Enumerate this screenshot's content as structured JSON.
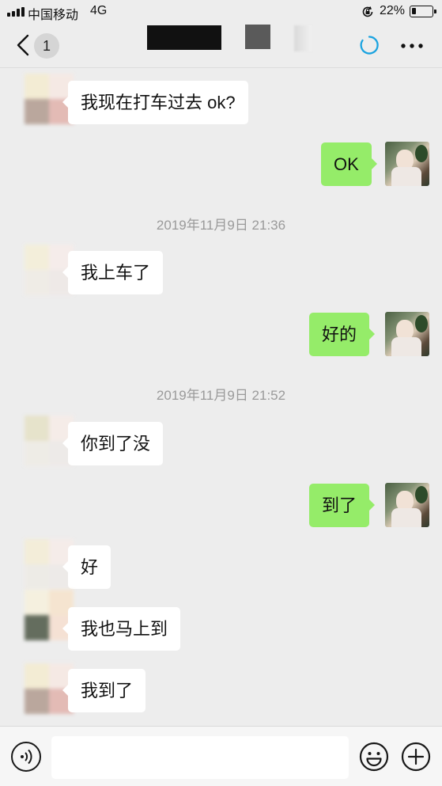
{
  "status_bar": {
    "carrier": "中国移动",
    "network": "4G",
    "battery_percent": "22%",
    "battery_level": 0.22
  },
  "nav": {
    "unread_count": "1"
  },
  "messages": [
    {
      "side": "in",
      "text": "我现在打车过去  ok?"
    },
    {
      "side": "out",
      "text": "OK"
    },
    {
      "type": "time",
      "text": "2019年11月9日 21:36"
    },
    {
      "side": "in",
      "text": "我上车了"
    },
    {
      "side": "out",
      "text": "好的"
    },
    {
      "type": "time",
      "text": "2019年11月9日 21:52"
    },
    {
      "side": "in",
      "text": "你到了没"
    },
    {
      "side": "out",
      "text": "到了"
    },
    {
      "side": "in",
      "text": "好"
    },
    {
      "side": "in",
      "text": "我也马上到"
    },
    {
      "side": "in",
      "text": "我到了"
    }
  ],
  "input": {
    "value": ""
  },
  "colors": {
    "outgoing_bubble": "#95ec69",
    "incoming_bubble": "#ffffff",
    "background": "#ededed",
    "accent": "#1aa3e0"
  },
  "icons": {
    "back": "chevron-left-icon",
    "sync": "sync-circle-icon",
    "more": "more-dots-icon",
    "voice": "voice-icon",
    "emoji": "emoji-icon",
    "plus": "plus-icon"
  }
}
